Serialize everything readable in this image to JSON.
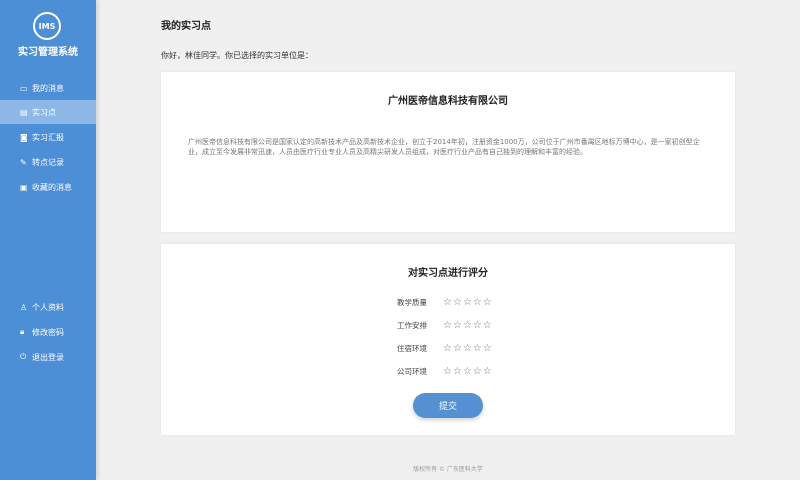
{
  "sidebar": {
    "logo": "IMS",
    "system_name": "实习管理系统",
    "items": [
      {
        "label": "我的消息",
        "icon": "message-icon"
      },
      {
        "label": "实习点",
        "icon": "building-icon"
      },
      {
        "label": "实习汇报",
        "icon": "report-icon"
      },
      {
        "label": "转点记录",
        "icon": "transfer-icon"
      },
      {
        "label": "收藏的消息",
        "icon": "favorite-icon"
      }
    ],
    "bottom": [
      {
        "label": "个人资料",
        "icon": "user-icon"
      },
      {
        "label": "修改密码",
        "icon": "lock-icon"
      },
      {
        "label": "退出登录",
        "icon": "power-icon"
      }
    ]
  },
  "page": {
    "title": "我的实习点",
    "greeting": "你好，林佳同学。你已选择的实习单位是："
  },
  "company": {
    "name": "广州医帝信息科技有限公司",
    "description": "广州医帝信息科技有限公司是国家认定的高新技术产品及高新技术企业，创立于2014年初，注册资金1000万，公司位于广州市番禺区地标万博中心，是一家初创型企业，成立至今发展非常迅速，人员由医疗行业专业人员及高精尖研发人员组成，对医疗行业产品有自己独到的理解和丰富的经验。"
  },
  "rating": {
    "title": "对实习点进行评分",
    "rows": [
      {
        "label": "教学质量",
        "stars": 0
      },
      {
        "label": "工作安排",
        "stars": 0
      },
      {
        "label": "住宿环境",
        "stars": 0
      },
      {
        "label": "公司环境",
        "stars": 0
      }
    ],
    "submit": "提交"
  },
  "footer": "版权所有 © 广东医科大学"
}
